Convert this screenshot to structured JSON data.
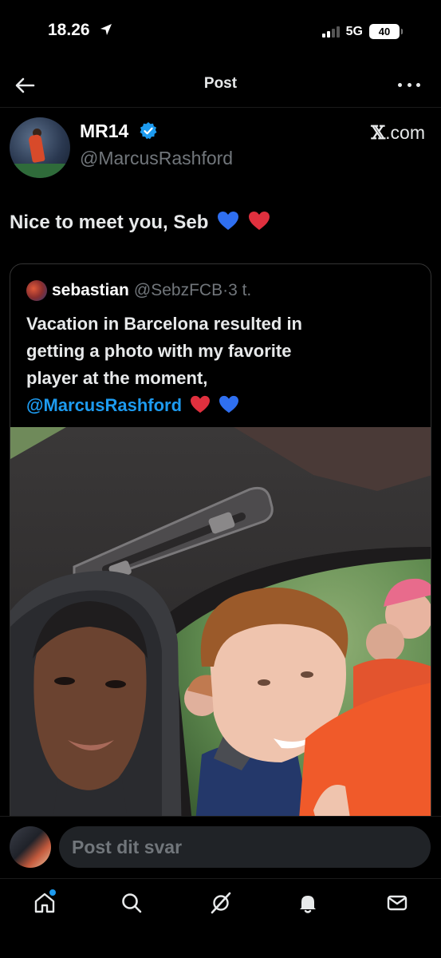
{
  "status_bar": {
    "time": "18.26",
    "network": "5G",
    "battery": "40"
  },
  "topbar": {
    "title": "Post"
  },
  "tweet": {
    "author_name": "MR14",
    "author_handle": "@MarcusRashford",
    "platform": ".com",
    "platform_mark": "𝕏",
    "text": "Nice to meet you, Seb",
    "emojis": [
      "blue-heart",
      "red-heart"
    ]
  },
  "quote": {
    "name": "sebastian",
    "handle": "@SebzFCB",
    "separator": "·",
    "time_ago": "3 t.",
    "text_lines": [
      "Vacation in Barcelona resulted in",
      "getting a photo with my favorite",
      "player at the moment,"
    ],
    "mention": "@MarcusRashford",
    "emojis": [
      "red-heart",
      "blue-heart"
    ]
  },
  "reply": {
    "placeholder": "Post dit svar"
  },
  "nav": {
    "items": [
      "home-icon",
      "search-icon",
      "grok-icon",
      "notifications-icon",
      "messages-icon"
    ],
    "unread_dot_on": "home-icon"
  },
  "colors": {
    "accent": "#1d9bf0",
    "background": "#000000",
    "secondary_text": "#71767b",
    "heart_red": "#e0303e",
    "heart_blue": "#2f6ff0"
  }
}
